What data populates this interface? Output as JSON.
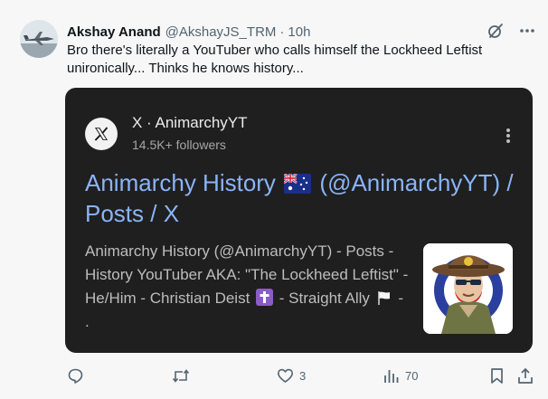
{
  "tweet": {
    "display_name": "Akshay Anand",
    "handle": "@AkshayJS_TRM",
    "separator": "·",
    "time": "10h",
    "text": "Bro there's literally a YouTuber who calls himself the Lockheed Leftist unironically... Thinks he knows history...",
    "avatar_icon": "fighter-jet-photo"
  },
  "header_icons": [
    "grok-icon",
    "more-icon"
  ],
  "card": {
    "site": "X · AnimarchyYT",
    "followers": "14.5K+ followers",
    "title_before_flag": "Animarchy History",
    "title_after_flag": "(@AnimarchyYT) / Posts / X",
    "desc_part1": "Animarchy History (@AnimarchyYT) - Posts - History YouTuber AKA: \"The Lockheed Leftist\" - He/Him - Christian Deist",
    "desc_part2": "- Straight Ally",
    "desc_part3": "- .",
    "title_color": "#8ab4f8",
    "background": "#1f1f1f"
  },
  "actions": {
    "reply_count": "",
    "retweet_count": "",
    "like_count": "3",
    "views_count": "70"
  },
  "colors": {
    "muted": "#536471",
    "text": "#0f1419"
  }
}
